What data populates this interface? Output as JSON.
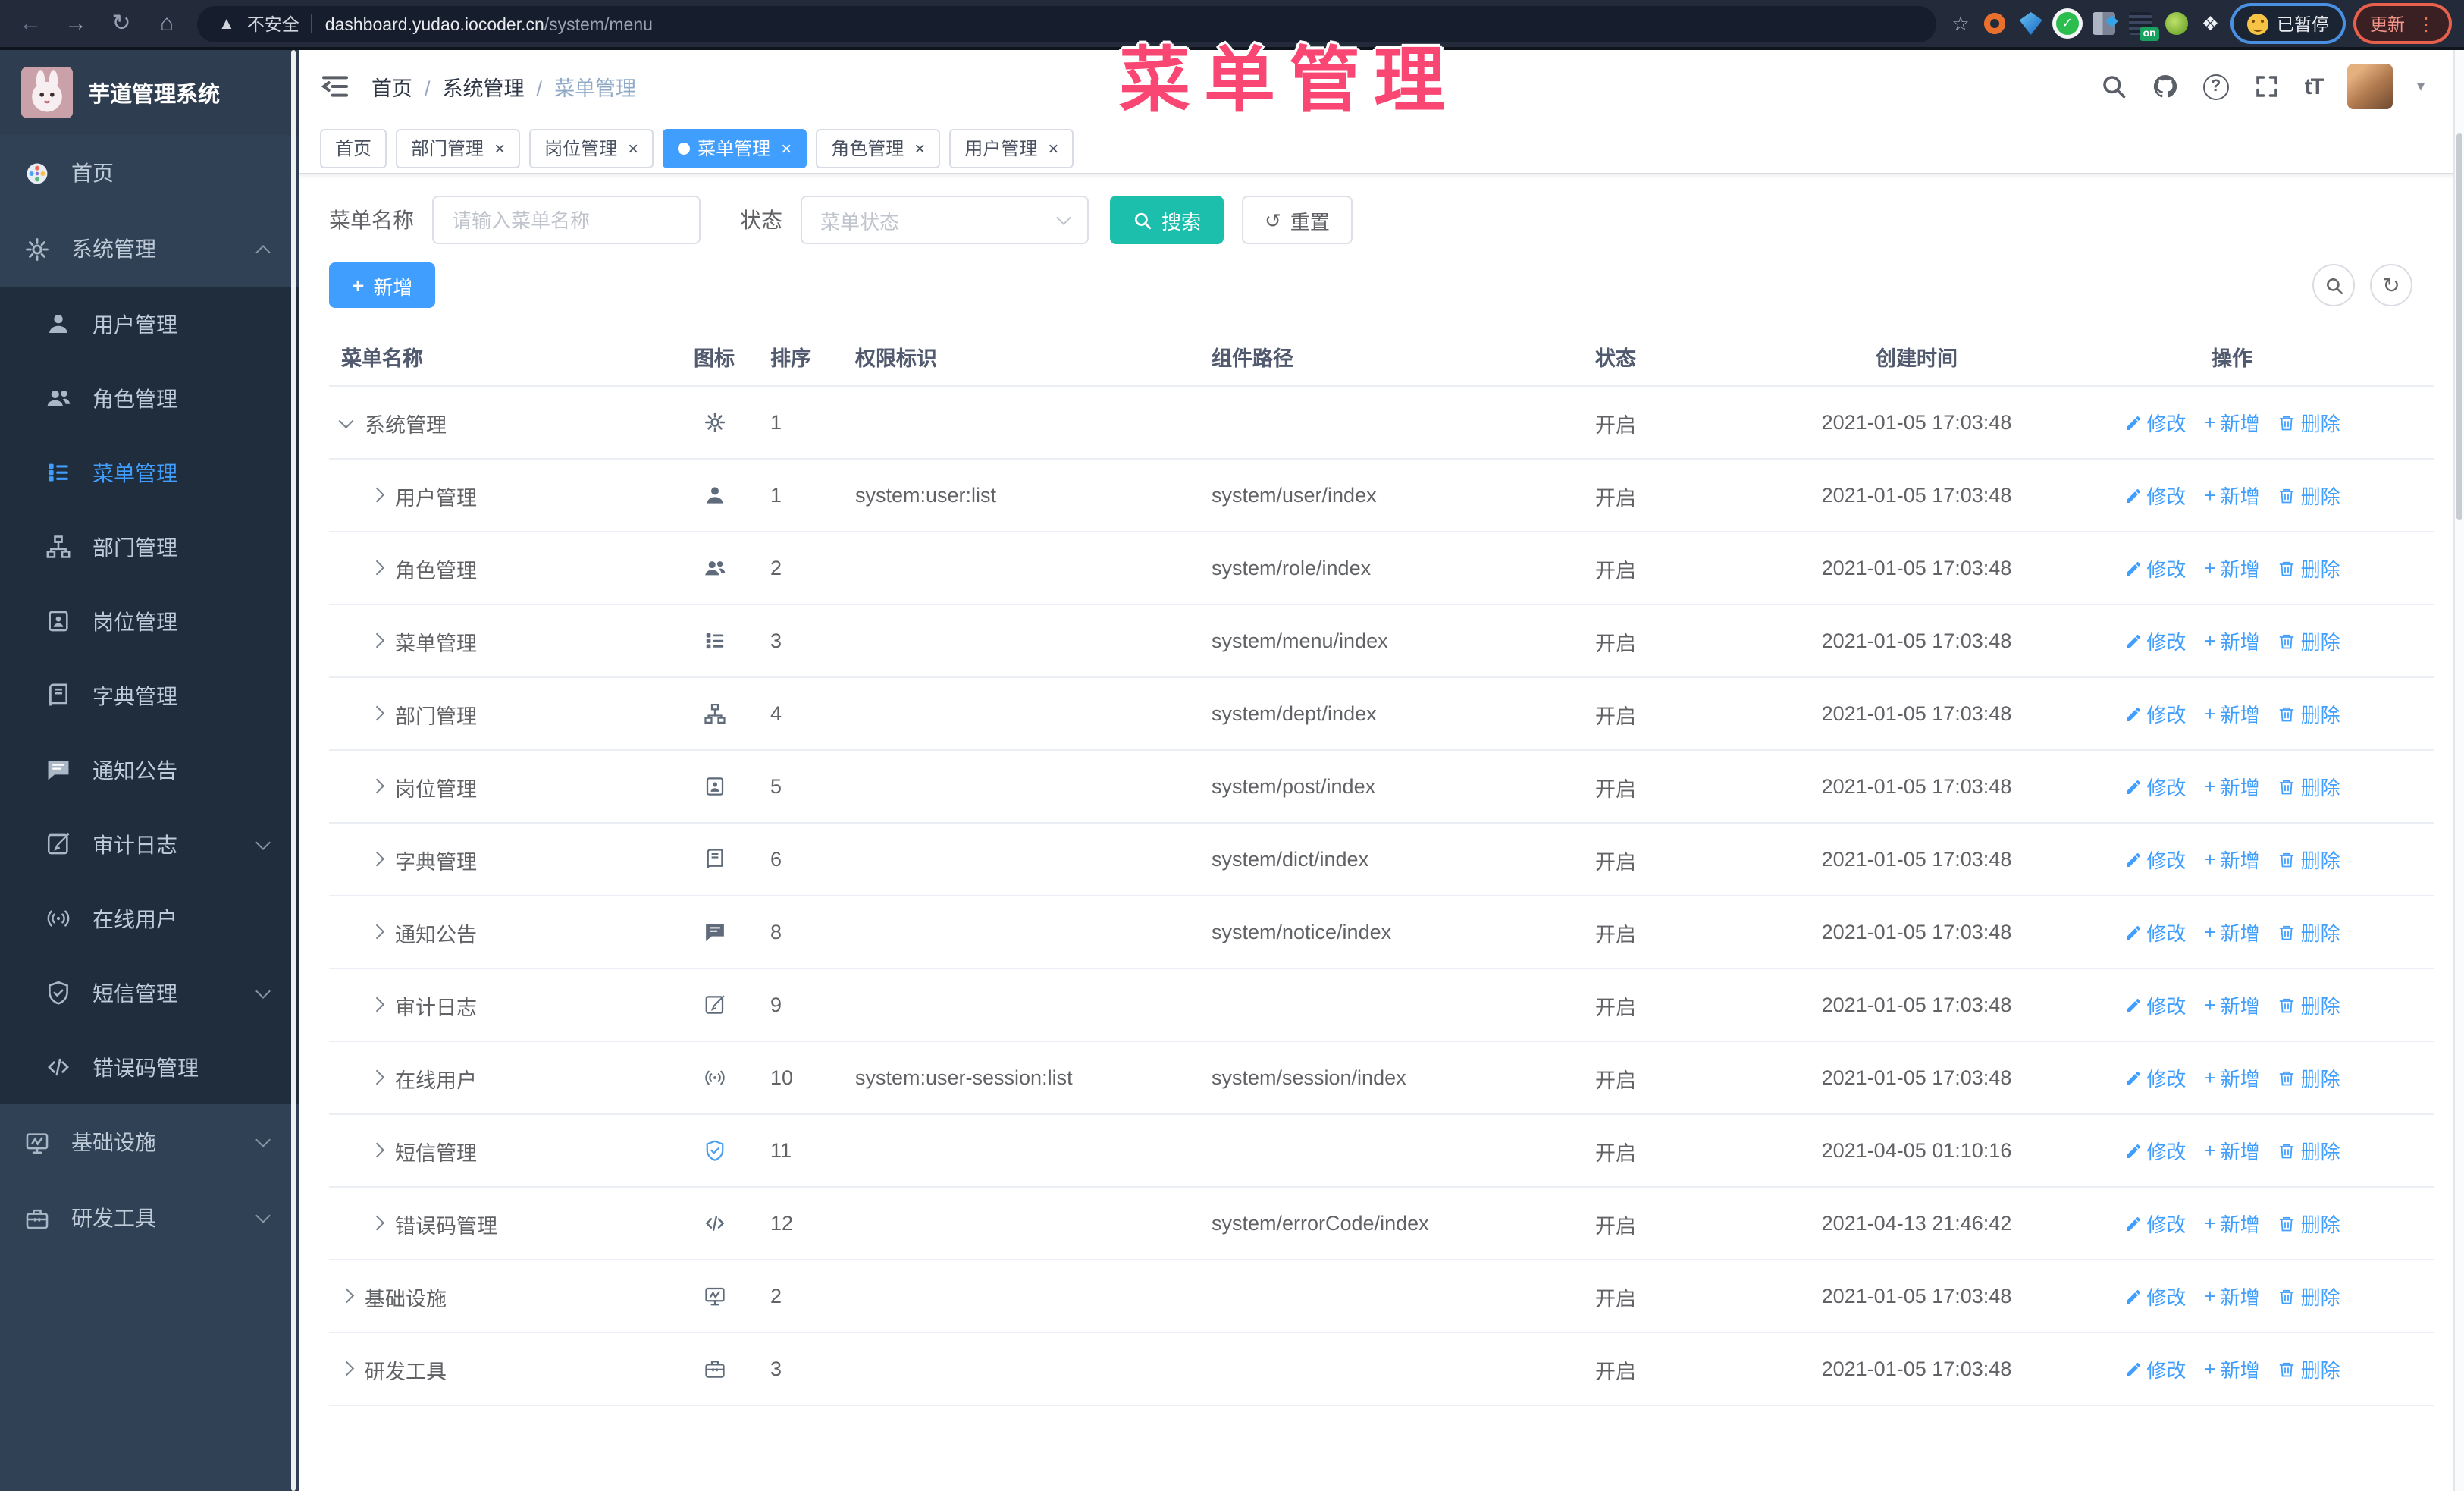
{
  "browser": {
    "security_label": "不安全",
    "url_host": "dashboard.yudao.iocoder.cn",
    "url_path": "/system/menu",
    "ext_on_label": "on",
    "profile_badge": "已暂停",
    "update_label": "更新"
  },
  "watermark": "菜单管理",
  "sidebar": {
    "title": "芋道管理系统",
    "items": [
      {
        "label": "首页",
        "icon": "home",
        "level": "top",
        "state": "normal",
        "chev": "none"
      },
      {
        "label": "系统管理",
        "icon": "gear",
        "level": "top",
        "state": "open",
        "chev": "up"
      },
      {
        "label": "用户管理",
        "icon": "user",
        "level": "sub",
        "state": "normal",
        "chev": "none"
      },
      {
        "label": "角色管理",
        "icon": "users",
        "level": "sub",
        "state": "normal",
        "chev": "none"
      },
      {
        "label": "菜单管理",
        "icon": "menu",
        "level": "sub",
        "state": "active",
        "chev": "none"
      },
      {
        "label": "部门管理",
        "icon": "tree",
        "level": "sub",
        "state": "normal",
        "chev": "none"
      },
      {
        "label": "岗位管理",
        "icon": "badge",
        "level": "sub",
        "state": "normal",
        "chev": "none"
      },
      {
        "label": "字典管理",
        "icon": "book",
        "level": "sub",
        "state": "normal",
        "chev": "none"
      },
      {
        "label": "通知公告",
        "icon": "chat",
        "level": "sub",
        "state": "normal",
        "chev": "none"
      },
      {
        "label": "审计日志",
        "icon": "edit",
        "level": "sub",
        "state": "normal",
        "chev": "down"
      },
      {
        "label": "在线用户",
        "icon": "online",
        "level": "sub",
        "state": "normal",
        "chev": "none"
      },
      {
        "label": "短信管理",
        "icon": "shield",
        "level": "sub",
        "state": "normal",
        "chev": "down"
      },
      {
        "label": "错误码管理",
        "icon": "code",
        "level": "sub",
        "state": "normal",
        "chev": "none"
      },
      {
        "label": "基础设施",
        "icon": "monitor",
        "level": "top",
        "state": "normal",
        "chev": "down"
      },
      {
        "label": "研发工具",
        "icon": "toolbox",
        "level": "top",
        "state": "normal",
        "chev": "down"
      }
    ]
  },
  "breadcrumb": [
    {
      "label": "首页"
    },
    {
      "label": "系统管理"
    },
    {
      "label": "菜单管理"
    }
  ],
  "tabs": [
    {
      "label": "首页",
      "state": "normal",
      "closable": false
    },
    {
      "label": "部门管理",
      "state": "normal",
      "closable": true
    },
    {
      "label": "岗位管理",
      "state": "normal",
      "closable": true
    },
    {
      "label": "菜单管理",
      "state": "active",
      "closable": true
    },
    {
      "label": "角色管理",
      "state": "normal",
      "closable": true
    },
    {
      "label": "用户管理",
      "state": "normal",
      "closable": true
    }
  ],
  "filters": {
    "name_label": "菜单名称",
    "name_placeholder": "请输入菜单名称",
    "status_label": "状态",
    "status_placeholder": "菜单状态",
    "search_label": "搜索",
    "reset_label": "重置"
  },
  "toolbar": {
    "add_label": "新增"
  },
  "table": {
    "columns": [
      "菜单名称",
      "图标",
      "排序",
      "权限标识",
      "组件路径",
      "状态",
      "创建时间",
      "操作"
    ],
    "ops": {
      "edit": "修改",
      "add": "新增",
      "delete": "删除"
    },
    "rows": [
      {
        "name": "系统管理",
        "icon": "gear",
        "level": "top",
        "expand": "down",
        "sort": "1",
        "perm": "",
        "component": "",
        "status": "开启",
        "time": "2021-01-05 17:03:48"
      },
      {
        "name": "用户管理",
        "icon": "user",
        "level": "sub",
        "expand": "right",
        "sort": "1",
        "perm": "system:user:list",
        "component": "system/user/index",
        "status": "开启",
        "time": "2021-01-05 17:03:48"
      },
      {
        "name": "角色管理",
        "icon": "users",
        "level": "sub",
        "expand": "right",
        "sort": "2",
        "perm": "",
        "component": "system/role/index",
        "status": "开启",
        "time": "2021-01-05 17:03:48"
      },
      {
        "name": "菜单管理",
        "icon": "menu",
        "level": "sub",
        "expand": "right",
        "sort": "3",
        "perm": "",
        "component": "system/menu/index",
        "status": "开启",
        "time": "2021-01-05 17:03:48"
      },
      {
        "name": "部门管理",
        "icon": "tree",
        "level": "sub",
        "expand": "right",
        "sort": "4",
        "perm": "",
        "component": "system/dept/index",
        "status": "开启",
        "time": "2021-01-05 17:03:48"
      },
      {
        "name": "岗位管理",
        "icon": "badge",
        "level": "sub",
        "expand": "right",
        "sort": "5",
        "perm": "",
        "component": "system/post/index",
        "status": "开启",
        "time": "2021-01-05 17:03:48"
      },
      {
        "name": "字典管理",
        "icon": "book",
        "level": "sub",
        "expand": "right",
        "sort": "6",
        "perm": "",
        "component": "system/dict/index",
        "status": "开启",
        "time": "2021-01-05 17:03:48"
      },
      {
        "name": "通知公告",
        "icon": "chat",
        "level": "sub",
        "expand": "right",
        "sort": "8",
        "perm": "",
        "component": "system/notice/index",
        "status": "开启",
        "time": "2021-01-05 17:03:48"
      },
      {
        "name": "审计日志",
        "icon": "edit",
        "level": "sub",
        "expand": "right",
        "sort": "9",
        "perm": "",
        "component": "",
        "status": "开启",
        "time": "2021-01-05 17:03:48"
      },
      {
        "name": "在线用户",
        "icon": "online",
        "level": "sub",
        "expand": "right",
        "sort": "10",
        "perm": "system:user-session:list",
        "component": "system/session/index",
        "status": "开启",
        "time": "2021-01-05 17:03:48"
      },
      {
        "name": "短信管理",
        "icon": "shield",
        "level": "sub",
        "expand": "right",
        "sort": "11",
        "perm": "",
        "component": "",
        "status": "开启",
        "time": "2021-04-05 01:10:16"
      },
      {
        "name": "错误码管理",
        "icon": "code",
        "level": "sub",
        "expand": "right",
        "sort": "12",
        "perm": "",
        "component": "system/errorCode/index",
        "status": "开启",
        "time": "2021-04-13 21:46:42"
      },
      {
        "name": "基础设施",
        "icon": "monitor",
        "level": "top",
        "expand": "right",
        "sort": "2",
        "perm": "",
        "component": "",
        "status": "开启",
        "time": "2021-01-05 17:03:48"
      },
      {
        "name": "研发工具",
        "icon": "toolbox",
        "level": "top",
        "expand": "right",
        "sort": "3",
        "perm": "",
        "component": "",
        "status": "开启",
        "time": "2021-01-05 17:03:48"
      }
    ]
  },
  "colors": {
    "primary": "#409eff",
    "search_teal": "#1cbeac",
    "watermark_pink": "#fa4672",
    "sidebar_bg": "#304156",
    "submenu_bg": "#1f2d3d"
  }
}
